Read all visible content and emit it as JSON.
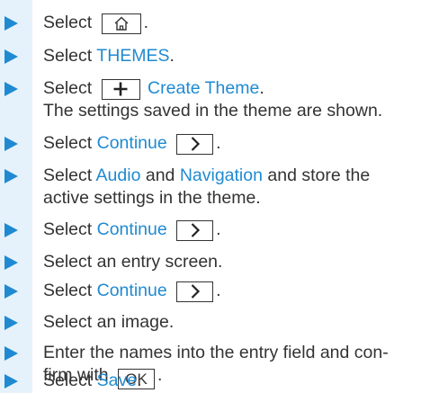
{
  "colors": {
    "accent": "#1f8ad1",
    "text": "#333333",
    "column": "#e6f2fb"
  },
  "steps": [
    {
      "pre": "Select",
      "icon": "home-icon",
      "post": "."
    },
    {
      "pre": "Select",
      "link": "THEMES",
      "post": "."
    },
    {
      "pre": "Select",
      "icon": "plus-icon",
      "link": "Create Theme",
      "post": ".",
      "desc": "The settings saved in the theme are shown."
    },
    {
      "pre": "Select",
      "link": "Continue",
      "icon": "chevron-right-icon",
      "post": "."
    },
    {
      "pre": "Select",
      "link": "Audio",
      "mid": "and",
      "link2": "Navigation",
      "post": "and store the",
      "desc": "active settings in the theme."
    },
    {
      "pre": "Select",
      "link": "Continue",
      "icon": "chevron-right-icon",
      "post": "."
    },
    {
      "text": "Select an entry screen."
    },
    {
      "pre": "Select",
      "link": "Continue",
      "icon": "chevron-right-icon",
      "post": "."
    },
    {
      "text": "Select an image."
    },
    {
      "line1": "Enter the names into the entry field and con-",
      "pre": "firm with",
      "key": "OK",
      "post": "."
    },
    {
      "pre": "Select",
      "link": "Save",
      "post": "."
    }
  ]
}
